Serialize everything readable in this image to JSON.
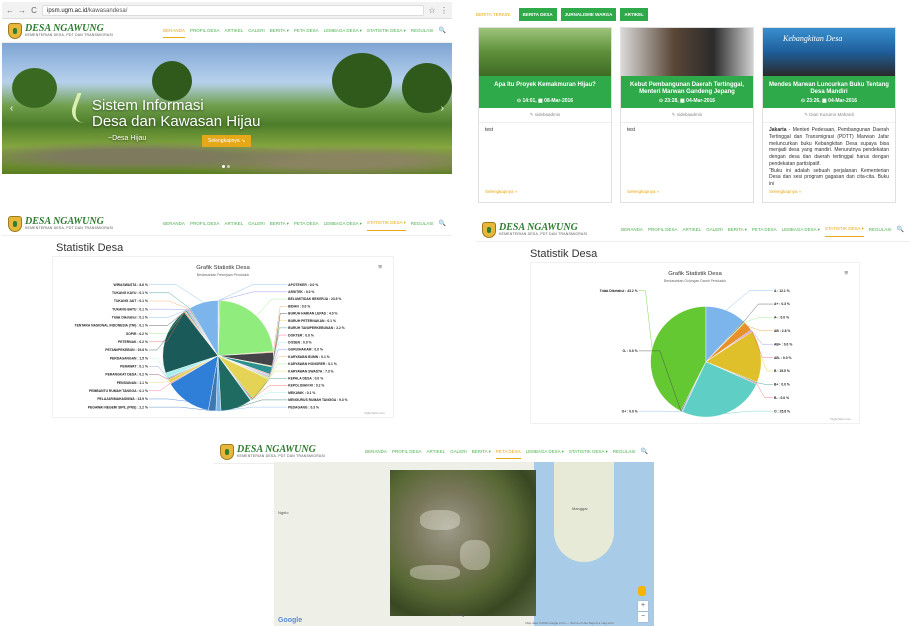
{
  "site": {
    "name": "DESA NGAWUNG",
    "tagline": "KEMENTERIAN DESA, PDT DAN TRANSMIGRASI"
  },
  "browser": {
    "back": "←",
    "forward": "→",
    "reload": "C",
    "url_host": "ipsm.ugm.ac.id",
    "url_path": "/kawasandesa/",
    "star": "☆",
    "menu": "⋮"
  },
  "nav": {
    "items": [
      "BERANDA",
      "PROFIL DESA",
      "ARTIKEL",
      "GALERI",
      "BERITA ▾",
      "PETA DESA",
      "LEMBAGA DESA ▾",
      "STATISTIK DESA ▾",
      "REGULASI"
    ],
    "search_icon": "🔍"
  },
  "hero": {
    "title_line1": "Sistem Informasi",
    "title_line2": "Desa dan Kawasan Hijau",
    "subtitle": "~Desa Hijau",
    "button": "Selengkapnya ↘",
    "prev": "‹",
    "next": "›"
  },
  "news": {
    "tabs": [
      "BERITA TERKINI",
      "BERITA DESA",
      "JURNALISME WARGA",
      "ARTIKEL"
    ],
    "cards": [
      {
        "title": "Apa Itu Proyek Kemakmuran Hijau?",
        "meta": "⊙ 14:01, ▦ 08-Mar-2016",
        "author": "✎ sidebaadmin",
        "body": "test",
        "more": "Selengkapnya »"
      },
      {
        "title": "Kebut Pembangunan Daerah Tertinggal, Menteri Marwan Gandeng Jepang",
        "meta": "⊙ 23:28, ▦ 04-Mar-2016",
        "author": "✎ sidebaadmin",
        "body": "test",
        "more": "Selengkapnya »"
      },
      {
        "title": "Mendes Marwan Luncurkan Buku Tentang Desa Mandiri",
        "meta": "⊙ 23:26, ▦ 04-Mar-2016",
        "author": "✎ Dian Kusumo Mahardi",
        "body_lead": "Jakarta",
        "body": " - Menteri Pedesaan, Pembangunan Daerah Tertinggal dan Transmigrasi (PDTT) Marwan Jafar meluncurkan buku Kebangkitan Desa supaya bisa menjadi desa yang mandiri. Menurutnya pendekatan dengan desa dan daerah tertinggal harus dengan pendekatan partisipatif.",
        "body2": "\"Buku ini adalah sebuah perjalanan Kementerian Desa dan sesi program gagasan dan cita-cita. Buku ini",
        "more": "Selengkapnya »",
        "banner": "Kebangkitan Desa"
      }
    ]
  },
  "stats": {
    "page_title": "Statistik Desa",
    "chart_title": "Grafik Statistik Desa",
    "menu_icon": "≡",
    "credit": "Highcharts.com"
  },
  "map": {
    "labels": [
      "Ngelo",
      "Manggar",
      "Gedang"
    ],
    "zoom_in": "+",
    "zoom_out": "−",
    "google": "Google",
    "footer": "Map data ©2016 Google   2 km ⎯⎯   Terms of Use   Report a map error"
  },
  "colors": {
    "green": "#2eaa4a",
    "nav_green": "#4caf50",
    "accent": "#e6a817"
  },
  "chart_data": [
    {
      "type": "pie",
      "title": "Grafik Statistik Desa",
      "subtitle": "Berdasarkan Pekerjaan Penduduk",
      "slices": [
        {
          "label": "APOTEKER : 0.0 %",
          "value": 0.3
        },
        {
          "label": "ARSITEK : 0.0 %",
          "value": 0.3
        },
        {
          "label": "BELUM/TIDAK BEKERJA : 23.5 %",
          "value": 23.5
        },
        {
          "label": "BIDAN : 0.0 %",
          "value": 0.3
        },
        {
          "label": "BURUH HARIAN LEPAS : 4.0 %",
          "value": 4.0
        },
        {
          "label": "BURUH PETERNAKAN : 0.1 %",
          "value": 0.3
        },
        {
          "label": "BURUH TANI/PERKEBUNAN : 2.2 %",
          "value": 2.2
        },
        {
          "label": "DOKTER : 0.0 %",
          "value": 0.3
        },
        {
          "label": "DOSEN : 0.0 %",
          "value": 0.3
        },
        {
          "label": "GURU/HAKAM : 0.0 %",
          "value": 0.3
        },
        {
          "label": "KARYAWAN BUMN : 0.1 %",
          "value": 0.3
        },
        {
          "label": "KARYAWAN HONORER : 0.1 %",
          "value": 0.3
        },
        {
          "label": "KARYAWAN SWASTA : 7.3 %",
          "value": 7.3
        },
        {
          "label": "KEPALA DESA : 0.0 %",
          "value": 0.3
        },
        {
          "label": "KEPOLISIAN RI : 0.2 %",
          "value": 0.3
        },
        {
          "label": "MEKANIK : 0.1 %",
          "value": 0.3
        },
        {
          "label": "MENGURUS RUMAH TANGGA : 9.3 %",
          "value": 9.3
        },
        {
          "label": "PEDAGANG : 0.3 %",
          "value": 1.5
        },
        {
          "label": "PEGAWAI NEGERI SIPIL (PNS) : 2.2 %",
          "value": 2.2
        },
        {
          "label": "PELAJAR/MAHASISWA : 13.9 %",
          "value": 13.9
        },
        {
          "label": "PEMBANTU RUMAH TANGGA : 0.1 %",
          "value": 0.3
        },
        {
          "label": "PENSIUNAN : 1.1 %",
          "value": 1.1
        },
        {
          "label": "PERANGKAT DESA : 0.2 %",
          "value": 0.3
        },
        {
          "label": "PERAWAT : 0.1 %",
          "value": 0.3
        },
        {
          "label": "PERDAGANGAN : 1.5 %",
          "value": 1.5
        },
        {
          "label": "PETANI/PEKEBUN : 19.8 %",
          "value": 19.8
        },
        {
          "label": "PETERNAK : 0.2 %",
          "value": 0.3
        },
        {
          "label": "SOPIR : 0.2 %",
          "value": 0.3
        },
        {
          "label": "TENTARA NASIONAL INDONESIA (TNI) : 0.1 %",
          "value": 0.3
        },
        {
          "label": "Tidak Diketahui : 0.1 %",
          "value": 0.3
        },
        {
          "label": "TUKANG BATU : 0.1 %",
          "value": 0.3
        },
        {
          "label": "TUKANG JAIT : 0.1 %",
          "value": 0.3
        },
        {
          "label": "TUKANG KAYU : 0.1 %",
          "value": 0.3
        },
        {
          "label": "WIRASWASTA : 8.6 %",
          "value": 8.6
        }
      ]
    },
    {
      "type": "pie",
      "title": "Grafik Statistik Desa",
      "subtitle": "Berdasarkan Golongan Darah Penduduk",
      "slices": [
        {
          "label": "A : 12.1 %",
          "value": 12.1
        },
        {
          "label": "A+ : 0.3 %",
          "value": 0.3
        },
        {
          "label": "A- : 0.0 %",
          "value": 0.3
        },
        {
          "label": "AB : 2.8 %",
          "value": 2.8
        },
        {
          "label": "AB+ : 0.0 %",
          "value": 0.3
        },
        {
          "label": "AB- : 0.0 %",
          "value": 0.3
        },
        {
          "label": "B : 15.5 %",
          "value": 15.5
        },
        {
          "label": "B+ : 0.0 %",
          "value": 0.3
        },
        {
          "label": "B- : 0.0 %",
          "value": 0.3
        },
        {
          "label": "O : 25.8 %",
          "value": 25.8
        },
        {
          "label": "O+ : 0.0 %",
          "value": 0.3
        },
        {
          "label": "O- : 0.0 %",
          "value": 0.3
        },
        {
          "label": "Tidak Diketahui : 43.2 %",
          "value": 43.2
        }
      ]
    }
  ]
}
